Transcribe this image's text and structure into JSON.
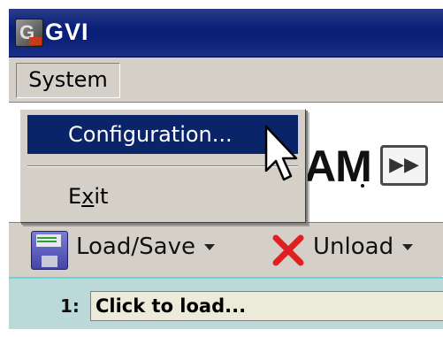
{
  "window": {
    "title": "GVI"
  },
  "menubar": {
    "system_label": "System"
  },
  "system_menu": {
    "items": [
      {
        "label": "Configuration...",
        "selected": true
      },
      {
        "label": "Exit",
        "mnemonic": "x",
        "selected": false
      }
    ]
  },
  "banner": {
    "brand_text": "AM",
    "skip_button_glyph": "▶▶"
  },
  "toolbar": {
    "load_save_label": "Load/Save",
    "unload_label": "Unload"
  },
  "load_row": {
    "slot_number": "1:",
    "field_text": "Click to load..."
  },
  "colors": {
    "titlebar": "#0a1f78",
    "menu_highlight": "#0a246a",
    "load_row_bg": "#bcd9d9",
    "unload_icon": "#e02020"
  },
  "icons": {
    "app": "gvi-app-icon",
    "load_save": "floppy-disk-icon",
    "unload": "red-x-icon",
    "skip": "fast-forward-icon",
    "pointer": "mouse-cursor-icon"
  }
}
